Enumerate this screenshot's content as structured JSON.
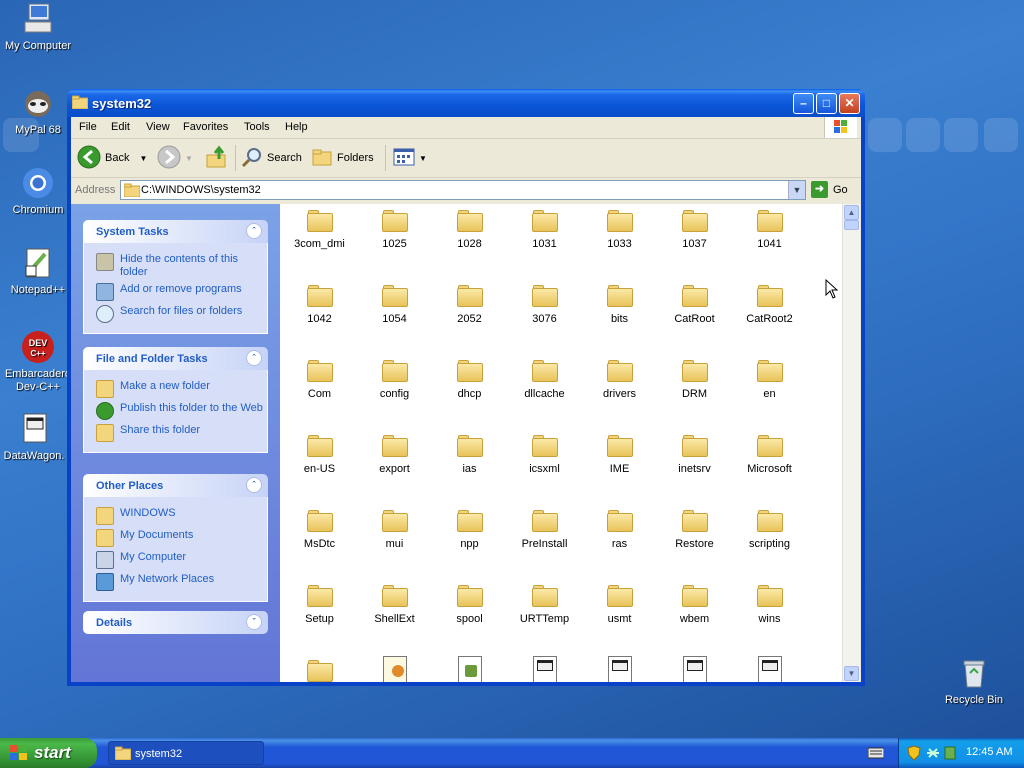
{
  "desktop": {
    "icons": [
      {
        "label": "My Computer",
        "icon": "my-computer-icon"
      },
      {
        "label": "MyPal 68",
        "icon": "mypal-icon"
      },
      {
        "label": "Chromium",
        "icon": "chromium-icon"
      },
      {
        "label": "Notepad++",
        "icon": "notepadpp-icon"
      },
      {
        "label": "Embarcadero Dev-C++",
        "icon": "devcpp-icon"
      },
      {
        "label": "DataWagon.",
        "icon": "datawagon-icon"
      },
      {
        "label": "Recycle Bin",
        "icon": "recycle-bin-icon"
      }
    ],
    "devcpp_badge": "DEV C++"
  },
  "window": {
    "title": "system32",
    "menu": [
      "File",
      "Edit",
      "View",
      "Favorites",
      "Tools",
      "Help"
    ],
    "toolbar": {
      "back": "Back",
      "search": "Search",
      "folders": "Folders"
    },
    "address": {
      "label": "Address",
      "value": "C:\\WINDOWS\\system32",
      "go": "Go"
    },
    "task_pane": {
      "panels": [
        {
          "title": "System Tasks",
          "items": [
            "Hide the contents of this folder",
            "Add or remove programs",
            "Search for files or folders"
          ]
        },
        {
          "title": "File and Folder Tasks",
          "items": [
            "Make a new folder",
            "Publish this folder to the Web",
            "Share this folder"
          ]
        },
        {
          "title": "Other Places",
          "items": [
            "WINDOWS",
            "My Documents",
            "My Computer",
            "My Network Places"
          ]
        },
        {
          "title": "Details",
          "items": []
        }
      ]
    },
    "files": [
      "3com_dmi",
      "1025",
      "1028",
      "1031",
      "1033",
      "1037",
      "1041",
      "1042",
      "1054",
      "2052",
      "3076",
      "bits",
      "CatRoot",
      "CatRoot2",
      "Com",
      "config",
      "dhcp",
      "dllcache",
      "drivers",
      "DRM",
      "en",
      "en-US",
      "export",
      "ias",
      "icsxml",
      "IME",
      "inetsrv",
      "Microsoft",
      "MsDtc",
      "mui",
      "npp",
      "PreInstall",
      "ras",
      "Restore",
      "scripting",
      "Setup",
      "ShellExt",
      "spool",
      "URTTemp",
      "usmt",
      "wbem",
      "wins"
    ]
  },
  "taskbar": {
    "start": "start",
    "task": "system32",
    "clock": "12:45 AM"
  }
}
